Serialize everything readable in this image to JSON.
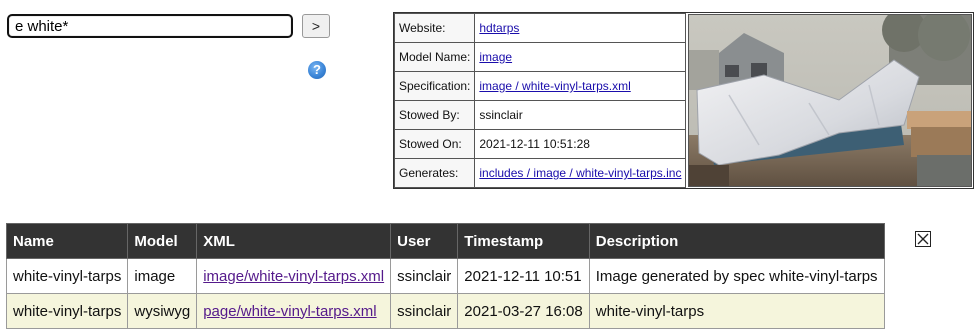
{
  "search": {
    "value": "e white*",
    "go_label": ">"
  },
  "help": {
    "glyph": "?"
  },
  "info": {
    "rows": [
      {
        "label": "Website:",
        "value": "hdtarps",
        "is_link": true
      },
      {
        "label": "Model Name:",
        "value": "image",
        "is_link": true
      },
      {
        "label": "Specification:",
        "value": "image / white-vinyl-tarps.xml",
        "is_link": true
      },
      {
        "label": "Stowed By:",
        "value": "ssinclair",
        "is_link": false
      },
      {
        "label": "Stowed On:",
        "value": "2021-12-11 10:51:28",
        "is_link": false
      },
      {
        "label": "Generates:",
        "value": "includes / image / white-vinyl-tarps.inc",
        "is_link": true
      }
    ]
  },
  "results": {
    "headers": [
      "Name",
      "Model",
      "XML",
      "User",
      "Timestamp",
      "Description"
    ],
    "rows": [
      {
        "name": "white-vinyl-tarps",
        "model": "image",
        "xml": "image/white-vinyl-tarps.xml",
        "user": "ssinclair",
        "timestamp": "2021-12-11 10:51",
        "description": "Image generated by spec white-vinyl-tarps"
      },
      {
        "name": "white-vinyl-tarps",
        "model": "wysiwyg",
        "xml": "page/white-vinyl-tarps.xml",
        "user": "ssinclair",
        "timestamp": "2021-03-27 16:08",
        "description": "white-vinyl-tarps"
      }
    ]
  },
  "colors": {
    "header_bg": "#333333",
    "row_alt_bg": "#f5f5dc",
    "link": "#1a0dab",
    "visited_link": "#551a8b"
  },
  "icons": [
    "help-icon",
    "close-box-icon"
  ]
}
